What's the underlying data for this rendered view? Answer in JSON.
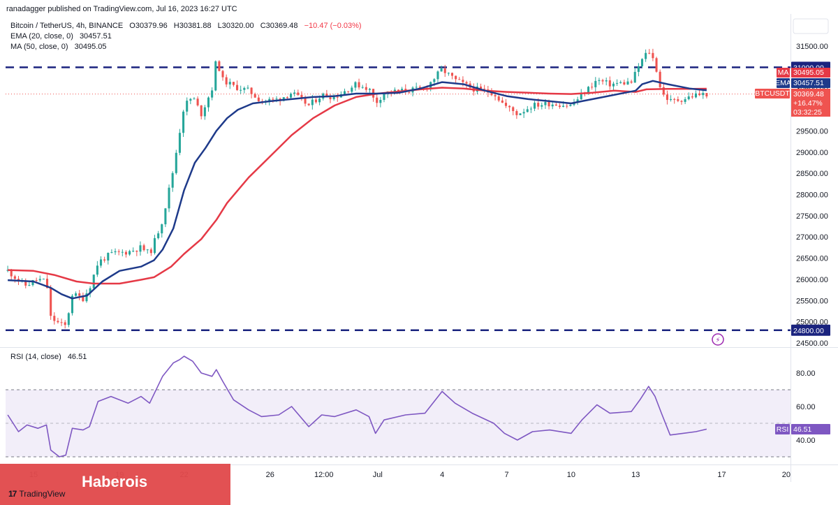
{
  "header": {
    "publisher": "ranadagger published on TradingView.com, Jul 16, 2023 16:27 UTC",
    "symbol": "Bitcoin / TetherUS, 4h, BINANCE",
    "ohlc": {
      "o": "O30379.96",
      "h": "H30381.88",
      "l": "L30320.00",
      "c": "C30369.48",
      "change": "−10.47 (−0.03%)"
    },
    "ema_label": "EMA (20, close, 0)",
    "ema_value": "30457.51",
    "ma_label": "MA (50, close, 0)",
    "ma_value": "30495.05",
    "rsi_label": "RSI (14, close)",
    "rsi_value": "46.51"
  },
  "right_labels": {
    "resistance": "31000.00",
    "ma_tag": "MA",
    "ma_value": "30495.05",
    "ema_tag": "EMA",
    "ema_value": "30457.51",
    "ticker": "BTCUSDT",
    "price": "30369.48",
    "pct": "+16.47%",
    "countdown": "03:32:25",
    "support": "24800.00",
    "rsi_tag": "RSI",
    "rsi_value": "46.51"
  },
  "badge": {
    "text": "Haberois"
  },
  "logo": {
    "text": "TradingView",
    "mark": "17"
  },
  "colors": {
    "up": "#26a69a",
    "down": "#ef5350",
    "ema": "#1e3a8a",
    "ma": "#e53946",
    "rsi": "#7e57c2",
    "levels": "#1a237e",
    "badge": "#e14a4c"
  },
  "chart_data": {
    "type": "candlestick",
    "title": "Bitcoin / TetherUS, 4h, BINANCE",
    "price_ticks": [
      24500,
      25000,
      25500,
      26000,
      26500,
      27000,
      27500,
      28000,
      28500,
      29000,
      29500,
      30000,
      30500,
      31000,
      31500
    ],
    "price_range": [
      24400,
      31950
    ],
    "horizontal_levels": [
      31000,
      24800
    ],
    "x_ticks": [
      "15",
      "19",
      "22",
      "26",
      "12:00",
      "Jul",
      "4",
      "7",
      "10",
      "13",
      "17",
      "20"
    ],
    "x_tick_days": [
      1,
      5,
      8,
      12,
      14.5,
      17,
      20,
      23,
      26,
      29,
      33,
      36
    ],
    "x_range_days": [
      -0.3,
      36.2
    ],
    "days_shown_on_axis": "Jun 15 = 1 ... Jul 17 = 33",
    "price_path": [
      [
        -0.2,
        26200
      ],
      [
        0.6,
        25850
      ],
      [
        1.2,
        26000
      ],
      [
        1.6,
        25950
      ],
      [
        1.8,
        25100
      ],
      [
        2.2,
        24950
      ],
      [
        2.5,
        24900
      ],
      [
        2.8,
        25650
      ],
      [
        3.3,
        25550
      ],
      [
        3.6,
        25800
      ],
      [
        4.0,
        26400
      ],
      [
        4.6,
        26600
      ],
      [
        5.4,
        26650
      ],
      [
        6.0,
        26750
      ],
      [
        6.4,
        26600
      ],
      [
        7.0,
        27400
      ],
      [
        7.5,
        28600
      ],
      [
        7.8,
        29500
      ],
      [
        8.0,
        30100
      ],
      [
        8.4,
        30300
      ],
      [
        8.8,
        29900
      ],
      [
        9.3,
        30500
      ],
      [
        9.5,
        31200
      ],
      [
        9.8,
        30700
      ],
      [
        10.3,
        30550
      ],
      [
        11.0,
        30450
      ],
      [
        11.6,
        30200
      ],
      [
        12.4,
        30250
      ],
      [
        13.0,
        30400
      ],
      [
        13.8,
        30100
      ],
      [
        14.4,
        30350
      ],
      [
        15.0,
        30300
      ],
      [
        16.0,
        30600
      ],
      [
        16.6,
        30500
      ],
      [
        16.9,
        30150
      ],
      [
        17.3,
        30400
      ],
      [
        18.3,
        30450
      ],
      [
        19.2,
        30500
      ],
      [
        20.0,
        30950
      ],
      [
        20.6,
        30700
      ],
      [
        21.4,
        30500
      ],
      [
        22.4,
        30400
      ],
      [
        22.9,
        30100
      ],
      [
        23.5,
        29900
      ],
      [
        24.2,
        30100
      ],
      [
        25.0,
        30150
      ],
      [
        26.0,
        30100
      ],
      [
        26.5,
        30350
      ],
      [
        27.2,
        30700
      ],
      [
        27.8,
        30600
      ],
      [
        28.8,
        30650
      ],
      [
        29.2,
        31100
      ],
      [
        29.6,
        31400
      ],
      [
        29.9,
        31100
      ],
      [
        30.2,
        30400
      ],
      [
        30.6,
        30200
      ],
      [
        31.2,
        30250
      ],
      [
        31.8,
        30350
      ],
      [
        32.3,
        30369
      ]
    ],
    "series": [
      {
        "name": "EMA (20, close, 0)",
        "points": [
          [
            -0.2,
            25980
          ],
          [
            1,
            25950
          ],
          [
            1.8,
            25800
          ],
          [
            2.3,
            25650
          ],
          [
            2.8,
            25550
          ],
          [
            3.5,
            25620
          ],
          [
            4.2,
            25950
          ],
          [
            5,
            26200
          ],
          [
            6,
            26300
          ],
          [
            6.6,
            26450
          ],
          [
            7,
            26700
          ],
          [
            7.5,
            27200
          ],
          [
            8,
            28100
          ],
          [
            8.5,
            28750
          ],
          [
            9,
            29100
          ],
          [
            9.5,
            29500
          ],
          [
            10,
            29800
          ],
          [
            10.5,
            30000
          ],
          [
            11.2,
            30150
          ],
          [
            12,
            30200
          ],
          [
            13,
            30250
          ],
          [
            14,
            30300
          ],
          [
            15,
            30320
          ],
          [
            16,
            30380
          ],
          [
            17,
            30380
          ],
          [
            18,
            30400
          ],
          [
            19,
            30500
          ],
          [
            20,
            30650
          ],
          [
            21,
            30600
          ],
          [
            22,
            30450
          ],
          [
            23,
            30320
          ],
          [
            24,
            30250
          ],
          [
            25,
            30200
          ],
          [
            26,
            30150
          ],
          [
            26.5,
            30200
          ],
          [
            27.5,
            30300
          ],
          [
            28.5,
            30400
          ],
          [
            29,
            30450
          ],
          [
            29.3,
            30600
          ],
          [
            29.8,
            30680
          ],
          [
            30.5,
            30600
          ],
          [
            31.5,
            30500
          ],
          [
            32.3,
            30457
          ]
        ]
      },
      {
        "name": "MA (50, close, 0)",
        "points": [
          [
            -0.2,
            26220
          ],
          [
            1,
            26200
          ],
          [
            2,
            26100
          ],
          [
            3,
            25950
          ],
          [
            3.8,
            25900
          ],
          [
            5,
            25900
          ],
          [
            6,
            25990
          ],
          [
            6.6,
            26050
          ],
          [
            7.4,
            26300
          ],
          [
            8,
            26600
          ],
          [
            8.8,
            26950
          ],
          [
            9.5,
            27400
          ],
          [
            10,
            27800
          ],
          [
            11,
            28400
          ],
          [
            12,
            28900
          ],
          [
            13,
            29400
          ],
          [
            14,
            29800
          ],
          [
            15,
            30100
          ],
          [
            16,
            30300
          ],
          [
            17,
            30380
          ],
          [
            18,
            30430
          ],
          [
            19,
            30480
          ],
          [
            20,
            30520
          ],
          [
            21,
            30500
          ],
          [
            22,
            30450
          ],
          [
            23,
            30420
          ],
          [
            24,
            30400
          ],
          [
            25,
            30380
          ],
          [
            26,
            30370
          ],
          [
            27,
            30400
          ],
          [
            28,
            30450
          ],
          [
            29,
            30420
          ],
          [
            29.5,
            30480
          ],
          [
            30.5,
            30490
          ],
          [
            31.5,
            30490
          ],
          [
            32.3,
            30495
          ]
        ]
      },
      {
        "name": "RSI (14, close)",
        "points": [
          [
            -0.2,
            55
          ],
          [
            0.3,
            45
          ],
          [
            0.7,
            49
          ],
          [
            1.2,
            47
          ],
          [
            1.6,
            49
          ],
          [
            1.8,
            34
          ],
          [
            2.2,
            30
          ],
          [
            2.5,
            31
          ],
          [
            2.8,
            47
          ],
          [
            3.3,
            46
          ],
          [
            3.6,
            48
          ],
          [
            4.0,
            63
          ],
          [
            4.6,
            66
          ],
          [
            5.4,
            62
          ],
          [
            6.0,
            66
          ],
          [
            6.4,
            62
          ],
          [
            7.0,
            78
          ],
          [
            7.5,
            86
          ],
          [
            7.8,
            88
          ],
          [
            8.0,
            90
          ],
          [
            8.4,
            87
          ],
          [
            8.8,
            80
          ],
          [
            9.3,
            78
          ],
          [
            9.5,
            82
          ],
          [
            9.8,
            75
          ],
          [
            10.3,
            64
          ],
          [
            11.0,
            58
          ],
          [
            11.6,
            54
          ],
          [
            12.4,
            55
          ],
          [
            13.0,
            60
          ],
          [
            13.8,
            48
          ],
          [
            14.4,
            55
          ],
          [
            15.0,
            54
          ],
          [
            16.0,
            58
          ],
          [
            16.6,
            54
          ],
          [
            16.9,
            44
          ],
          [
            17.3,
            52
          ],
          [
            18.3,
            55
          ],
          [
            19.2,
            56
          ],
          [
            20.0,
            69
          ],
          [
            20.6,
            62
          ],
          [
            21.4,
            56
          ],
          [
            22.4,
            50
          ],
          [
            22.9,
            44
          ],
          [
            23.5,
            40
          ],
          [
            24.2,
            45
          ],
          [
            25.0,
            46
          ],
          [
            26.0,
            44
          ],
          [
            26.5,
            52
          ],
          [
            27.2,
            61
          ],
          [
            27.8,
            56
          ],
          [
            28.8,
            57
          ],
          [
            29.2,
            64
          ],
          [
            29.6,
            72
          ],
          [
            29.9,
            66
          ],
          [
            30.2,
            56
          ],
          [
            30.6,
            43
          ],
          [
            31.2,
            44
          ],
          [
            31.8,
            45
          ],
          [
            32.3,
            46.51
          ]
        ]
      }
    ],
    "rsi_ticks": [
      40,
      60,
      80
    ],
    "rsi_range": [
      28,
      96
    ],
    "rsi_band": [
      30,
      70
    ],
    "rsi_mid": 50,
    "last_price": 30369.48
  }
}
